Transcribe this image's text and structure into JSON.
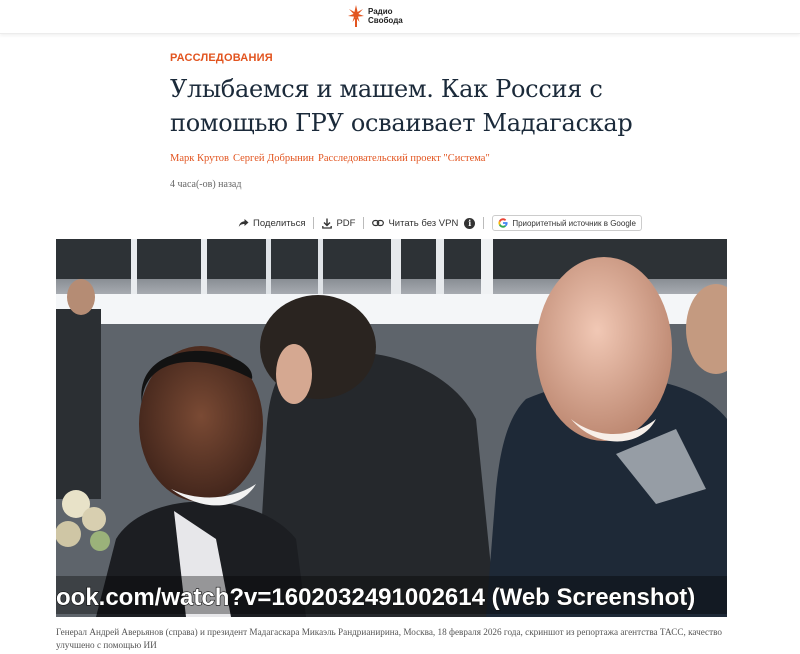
{
  "header": {
    "logo_line1": "Радио",
    "logo_line2": "Свобода",
    "accent_color": "#e2541f"
  },
  "article": {
    "rubric": "РАССЛЕДОВАНИЯ",
    "title": "Улыбаемся и машем. Как Россия с помощью ГРУ осваивает Мадагаскар",
    "authors": [
      "Марк Крутов",
      "Сергей Добрынин",
      "Расследовательский проект \"Система\""
    ],
    "published": "4 часа(-ов) назад"
  },
  "sharebar": {
    "share_label": "Поделиться",
    "pdf_label": "PDF",
    "vpn_label": "Читать без VPN",
    "info_glyph": "i",
    "google_label": "Приоритетный источник в Google"
  },
  "photo": {
    "watermark_text": "ook.com/watch?v=1602032491002614 (Web Screenshot)",
    "caption": "Генерал Андрей Аверьянов (справа) и президент Мадагаскара Микаэль Рандрианирина, Москва, 18 февраля 2026 года, скриншот из репортажа агентства ТАСС, качество улучшено с помощью ИИ"
  },
  "icons": {
    "logo": "radio-svoboda-torch-icon",
    "share": "share-arrow-icon",
    "pdf": "download-icon",
    "vpn": "link-icon",
    "info": "info-icon",
    "google": "google-g-icon"
  }
}
